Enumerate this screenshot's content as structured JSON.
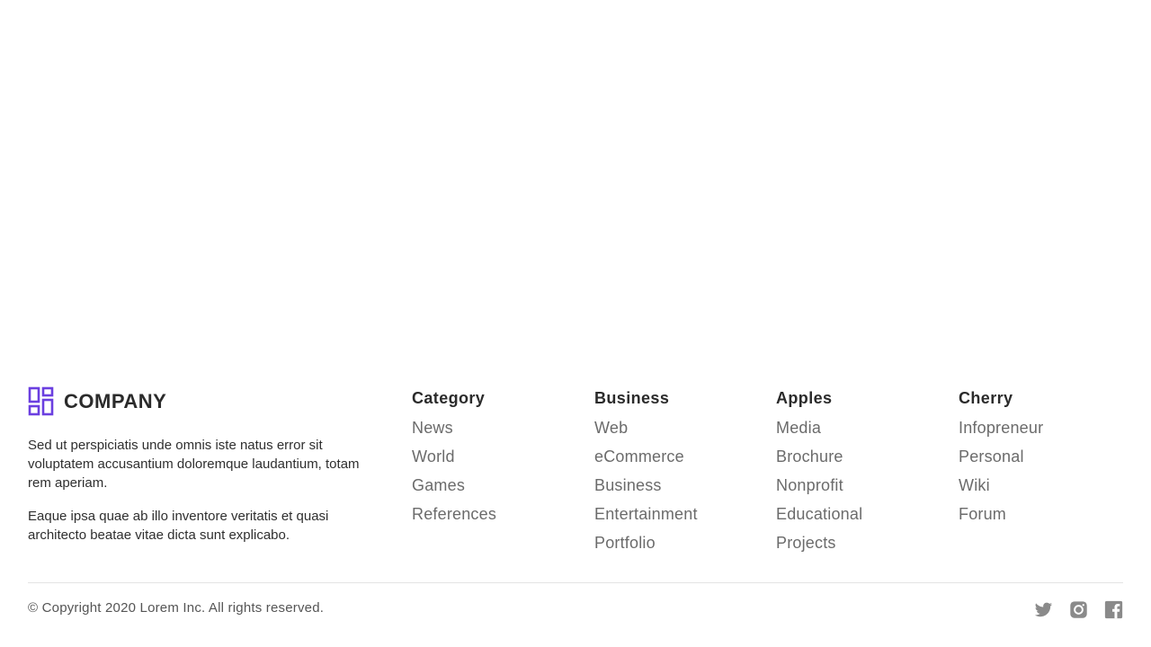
{
  "brand": {
    "name": "COMPANY",
    "logo_icon": "grid-layout-icon",
    "accent_color": "#6b3fe0"
  },
  "about": {
    "paragraph1": "Sed ut perspiciatis unde omnis iste natus error sit voluptatem accusantium doloremque laudantium, totam rem aperiam.",
    "paragraph2": "Eaque ipsa quae ab illo inventore veritatis et quasi architecto beatae vitae dicta sunt explicabo."
  },
  "columns": [
    {
      "title": "Category",
      "links": [
        "News",
        "World",
        "Games",
        "References"
      ]
    },
    {
      "title": "Business",
      "links": [
        "Web",
        "eCommerce",
        "Business",
        "Entertainment",
        "Portfolio"
      ]
    },
    {
      "title": "Apples",
      "links": [
        "Media",
        "Brochure",
        "Nonprofit",
        "Educational",
        "Projects"
      ]
    },
    {
      "title": "Cherry",
      "links": [
        "Infopreneur",
        "Personal",
        "Wiki",
        "Forum"
      ]
    }
  ],
  "footer": {
    "copyright": "© Copyright 2020 Lorem Inc. All rights reserved."
  },
  "social": [
    {
      "icon": "twitter-icon"
    },
    {
      "icon": "instagram-icon"
    },
    {
      "icon": "facebook-icon"
    }
  ]
}
